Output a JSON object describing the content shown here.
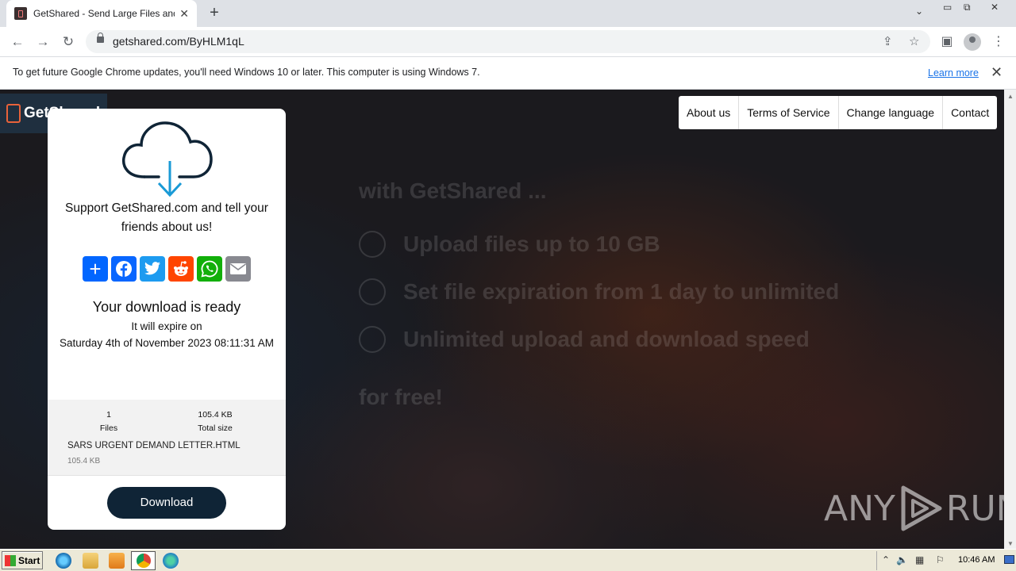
{
  "browser": {
    "tab_title": "GetShared - Send Large Files and Sh",
    "tab_close": "✕",
    "new_tab": "+",
    "url": "getshared.com/ByHLM1qL",
    "infobar_text": "To get future Google Chrome updates, you'll need Windows 10 or later. This computer is using Windows 7.",
    "infobar_link": "Learn more",
    "infobar_close": "✕"
  },
  "site": {
    "logo_text": "GetShared",
    "nav": [
      "About us",
      "Terms of Service",
      "Change language",
      "Contact"
    ],
    "hero_title": "with GetShared ...",
    "features": [
      "Upload files up to 10 GB",
      "Set file expiration from 1 day to unlimited",
      "Unlimited upload and download speed"
    ],
    "hero_foot": "for free!"
  },
  "card": {
    "support_text": "Support GetShared.com and tell your friends about us!",
    "share_buttons": [
      {
        "name": "share",
        "color": "#0166ff"
      },
      {
        "name": "facebook",
        "color": "#0866ff"
      },
      {
        "name": "twitter",
        "color": "#1d9bf0"
      },
      {
        "name": "reddit",
        "color": "#ff4500"
      },
      {
        "name": "whatsapp",
        "color": "#12af0a"
      },
      {
        "name": "email",
        "color": "#888990"
      }
    ],
    "ready_title": "Your download is ready",
    "expire_label": "It will expire on",
    "expire_date": "Saturday 4th of November 2023 08:11:31 AM",
    "files_count": "1",
    "files_label": "Files",
    "total_size": "105.4 KB",
    "total_size_label": "Total size",
    "file_name": "SARS URGENT DEMAND LETTER.HTML",
    "file_size": "105.4 KB",
    "download_label": "Download"
  },
  "watermark": {
    "left": "ANY",
    "right": "RUN"
  },
  "taskbar": {
    "start_label": "Start",
    "clock": "10:46 AM"
  },
  "colors": {
    "accent": "#0f2436",
    "cloud_arrow": "#1a9ad6",
    "logo_orange": "#e8623a"
  }
}
